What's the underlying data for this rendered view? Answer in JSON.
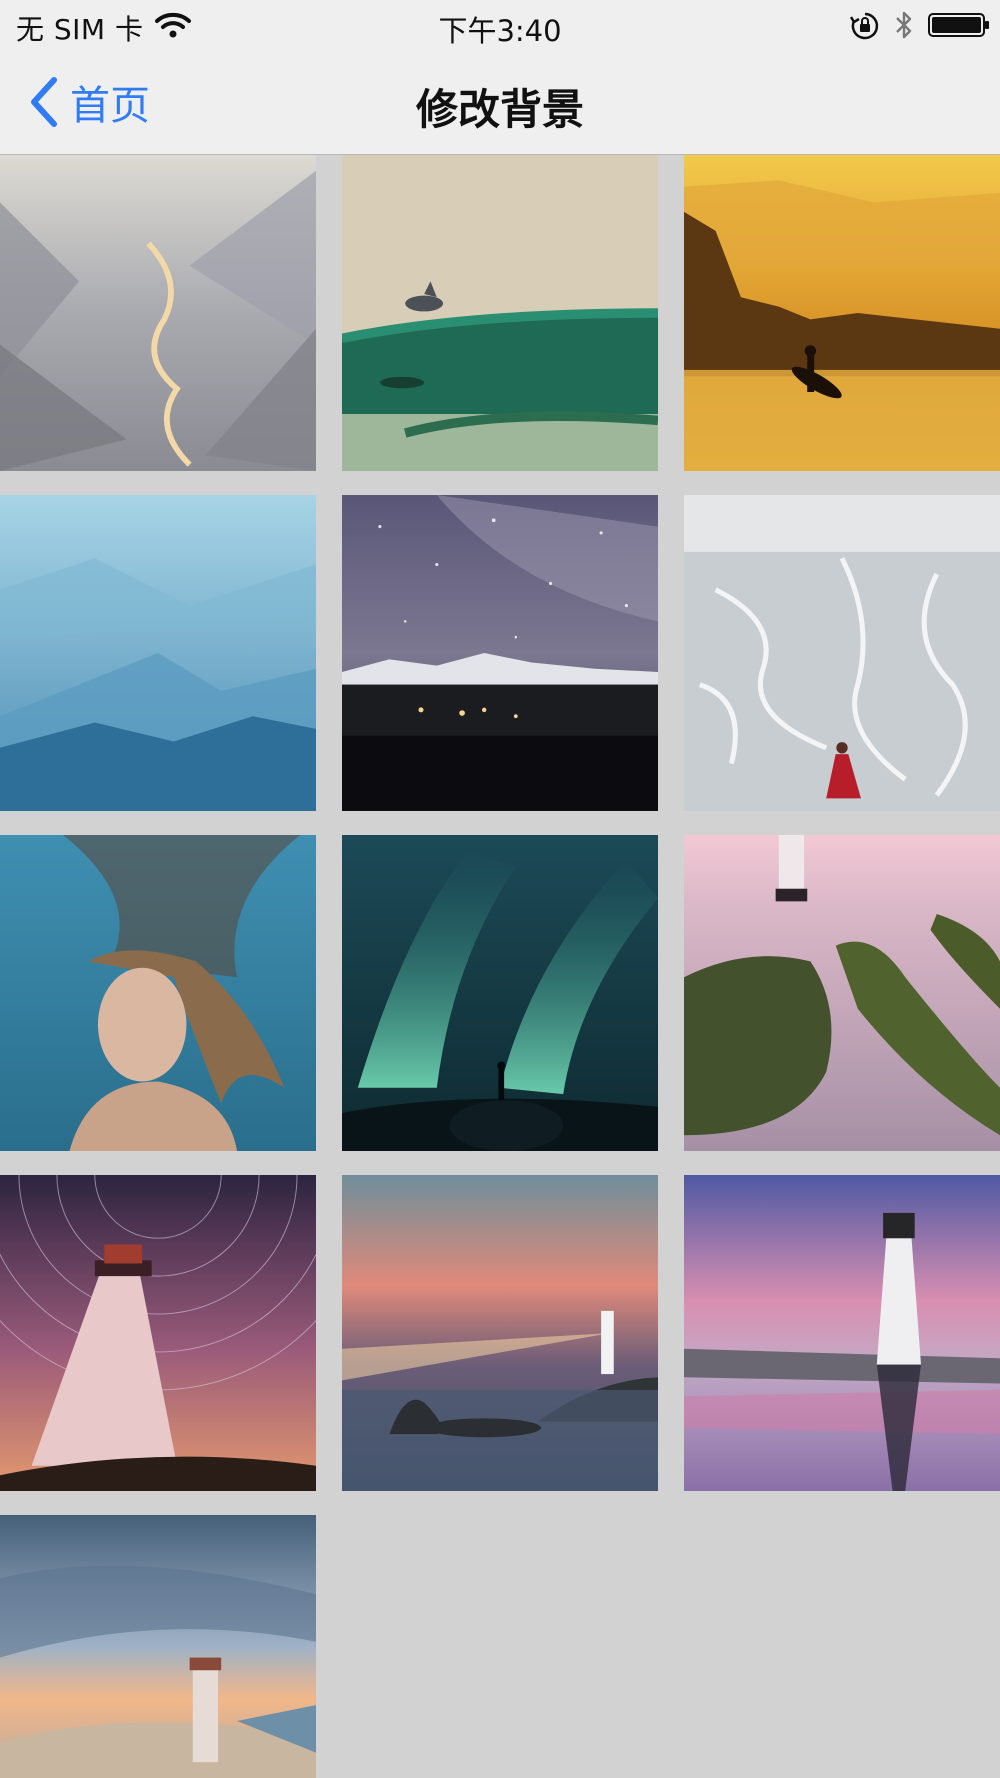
{
  "status_bar": {
    "carrier": "无 SIM 卡",
    "time": "下午3:40",
    "icons": [
      "wifi-icon",
      "orientation-lock-icon",
      "bluetooth-icon",
      "battery-icon"
    ]
  },
  "nav": {
    "back_label": "首页",
    "title": "修改背景",
    "accent_color": "#2f7cf6"
  },
  "backgrounds": [
    {
      "subject": "misty valley with river"
    },
    {
      "subject": "dolphin on green wave"
    },
    {
      "subject": "surfer silhouette at golden sunset"
    },
    {
      "subject": "blue mountain ranges"
    },
    {
      "subject": "milky way over lake"
    },
    {
      "subject": "braided river from above with woman in red"
    },
    {
      "subject": "underwater woman portrait"
    },
    {
      "subject": "aurora with person on rock"
    },
    {
      "subject": "lighthouse and mossy rocks"
    },
    {
      "subject": "lighthouse with star trails"
    },
    {
      "subject": "lighthouse with beam at dusk"
    },
    {
      "subject": "lighthouse reflected at pink sunset"
    },
    {
      "subject": "lighthouse on sand dunes"
    }
  ]
}
